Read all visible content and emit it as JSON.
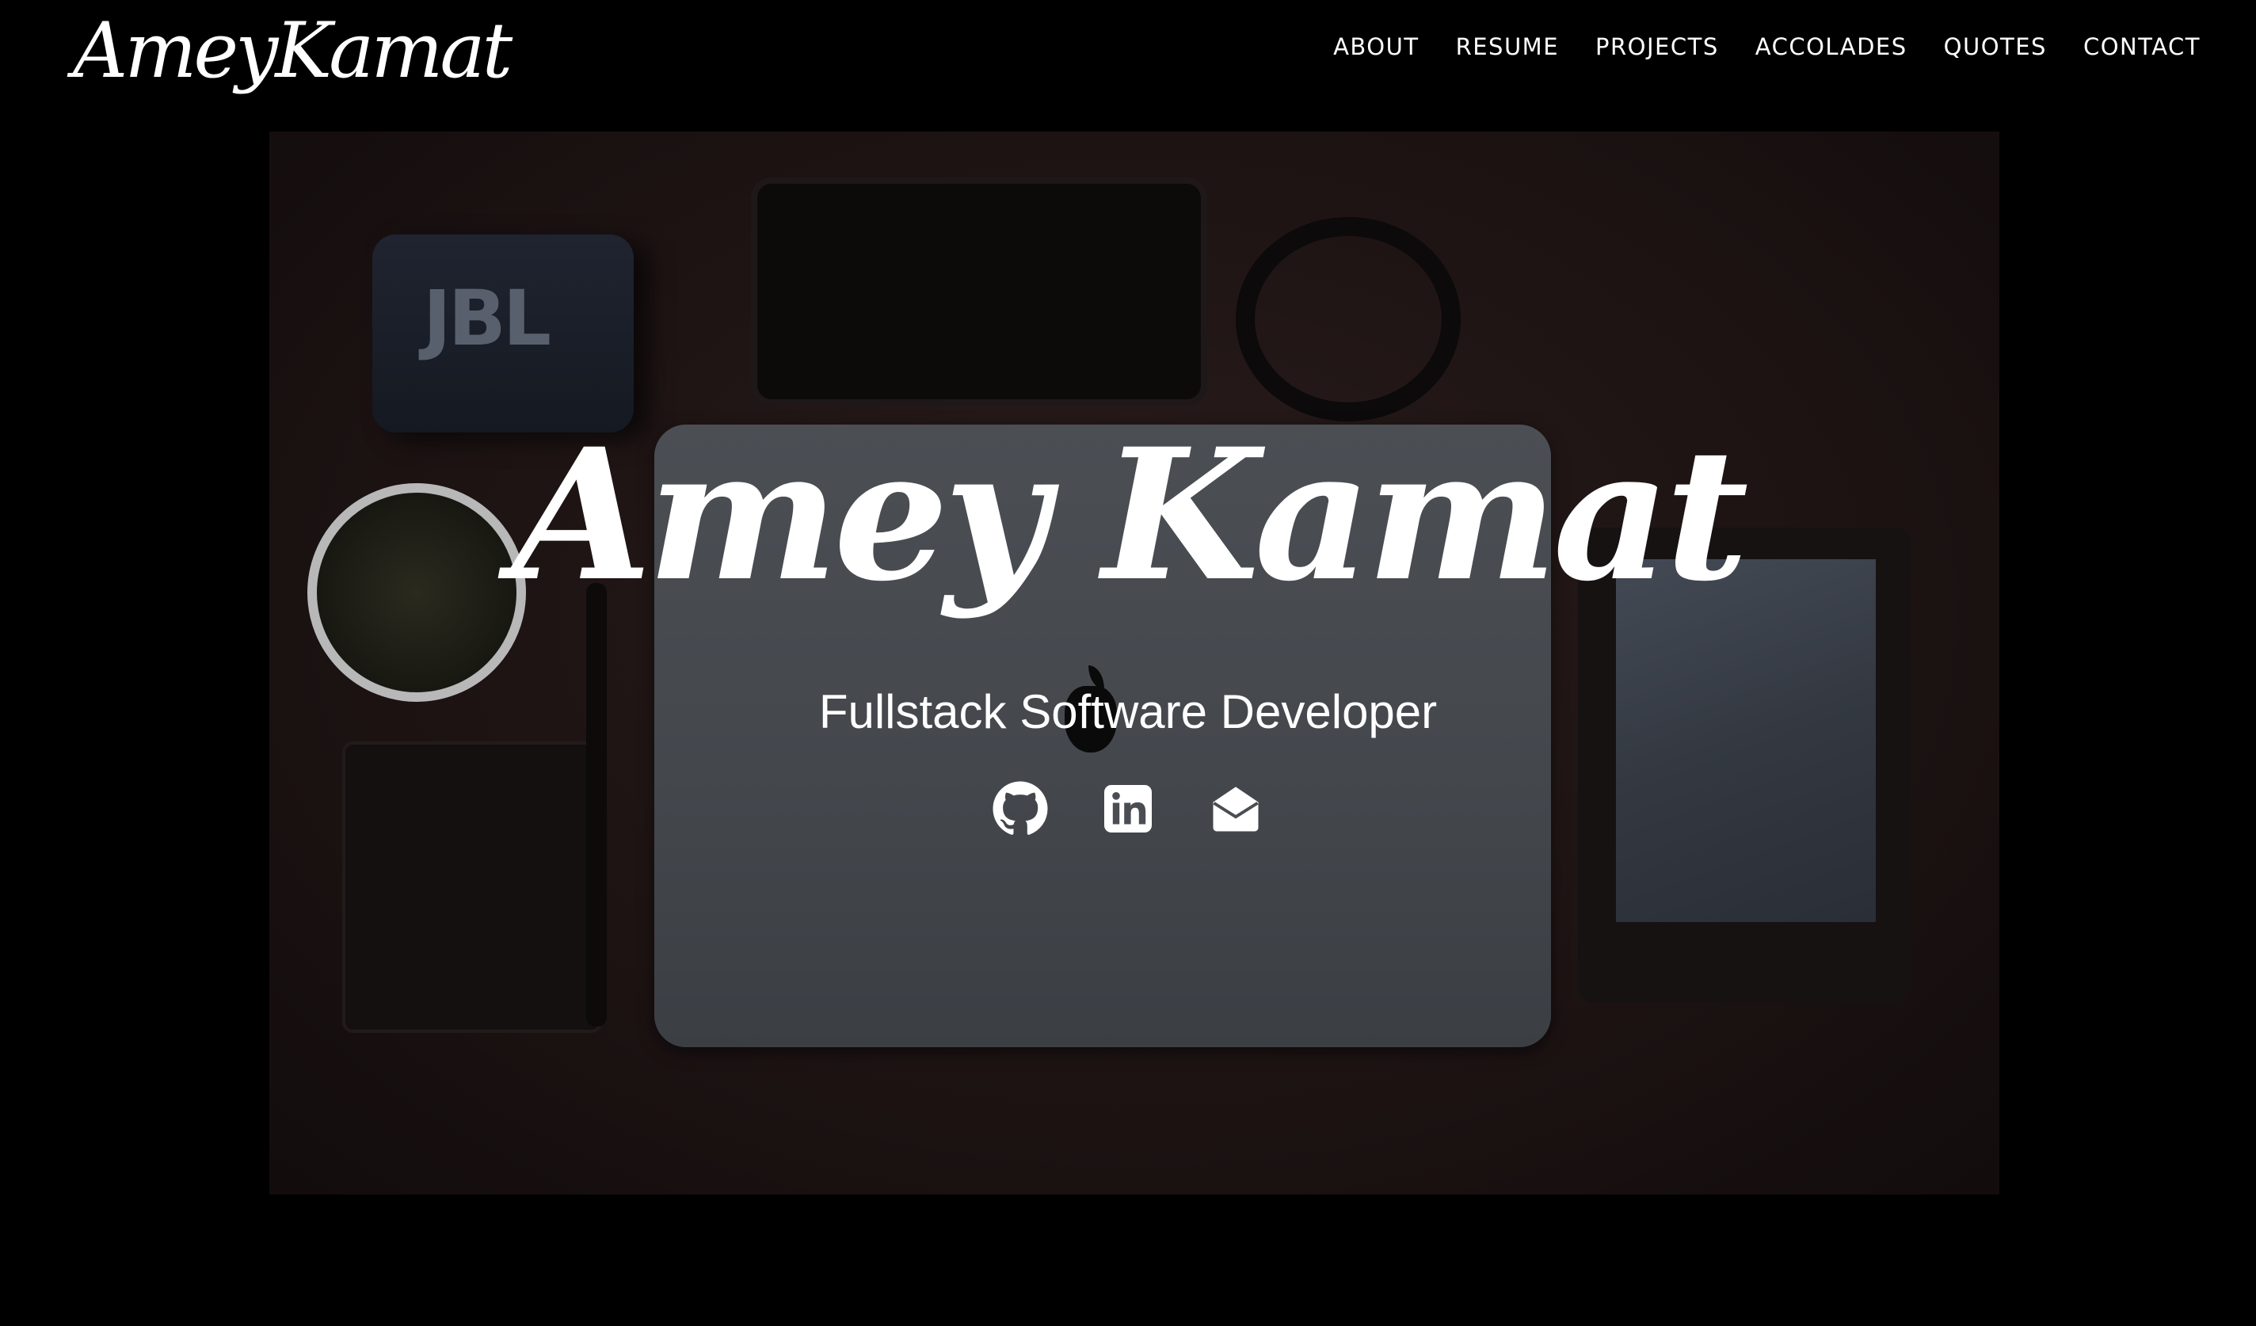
{
  "header": {
    "brand": "AmeyKamat",
    "nav": [
      {
        "label": "ABOUT"
      },
      {
        "label": "RESUME"
      },
      {
        "label": "PROJECTS"
      },
      {
        "label": "ACCOLADES"
      },
      {
        "label": "QUOTES"
      },
      {
        "label": "CONTACT"
      }
    ]
  },
  "hero": {
    "photo_speaker_logo": "JBL",
    "name": "Amey Kamat",
    "role": "Fullstack Software Developer",
    "social": [
      {
        "icon": "github-icon"
      },
      {
        "icon": "linkedin-icon"
      },
      {
        "icon": "envelope-icon"
      }
    ]
  },
  "colors": {
    "background": "#000000",
    "text": "#ffffff"
  }
}
